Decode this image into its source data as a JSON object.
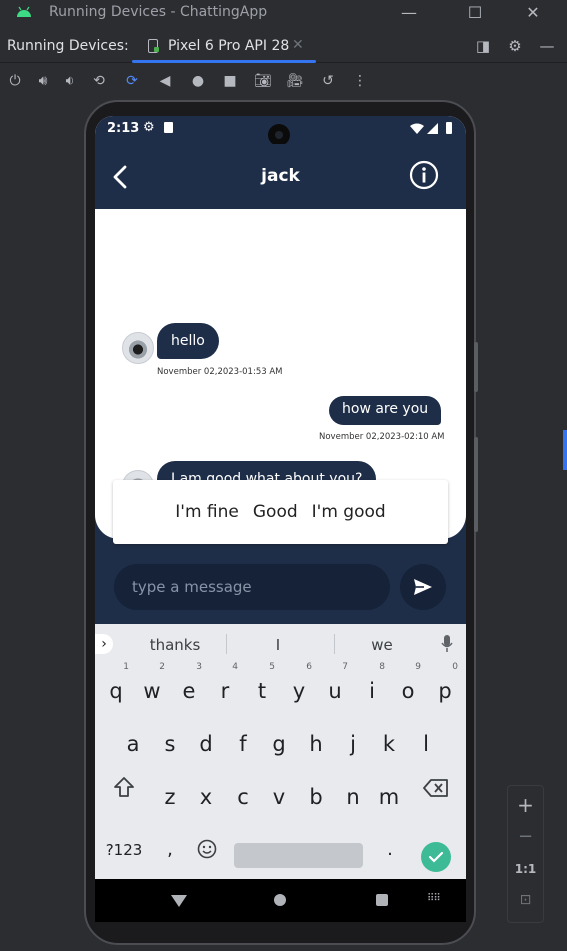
{
  "ide": {
    "window_title": "Running Devices - ChattingApp",
    "panel_label": "Running Devices:",
    "device_tab": "Pixel 6 Pro API 28",
    "zoom_ratio": "1:1"
  },
  "phone": {
    "status_time": "2:13",
    "contact_name": "jack",
    "messages": [
      {
        "text": "hello",
        "timestamp": "November 02,2023-01:53 AM",
        "direction": "incoming"
      },
      {
        "text": "how are you",
        "timestamp": "November 02,2023-02:10 AM",
        "direction": "outgoing"
      },
      {
        "text": "I am good what about you?",
        "direction": "incoming"
      }
    ],
    "smart_replies": [
      "I'm fine",
      "Good",
      "I'm good"
    ],
    "input_placeholder": "type a message",
    "keyboard": {
      "suggestions": [
        "thanks",
        "I",
        "we"
      ],
      "row1": [
        "q",
        "w",
        "e",
        "r",
        "t",
        "y",
        "u",
        "i",
        "o",
        "p"
      ],
      "row1_hints": [
        "1",
        "2",
        "3",
        "4",
        "5",
        "6",
        "7",
        "8",
        "9",
        "0"
      ],
      "row2": [
        "a",
        "s",
        "d",
        "f",
        "g",
        "h",
        "j",
        "k",
        "l"
      ],
      "row3": [
        "z",
        "x",
        "c",
        "v",
        "b",
        "n",
        "m"
      ],
      "symbols_key": "?123",
      "comma": ",",
      "period": "."
    }
  },
  "colors": {
    "ide_bg": "#2b2d30",
    "app_primary": "#1f2e48",
    "accent_blue": "#3574f0",
    "keyboard_done": "#3dbb96"
  }
}
